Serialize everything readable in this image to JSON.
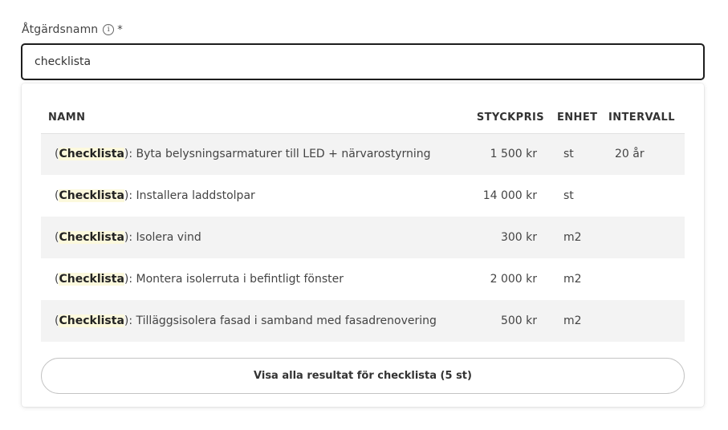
{
  "field": {
    "label": "Åtgärdsnamn",
    "required_marker": "*",
    "info_glyph": "i",
    "value": "checklista"
  },
  "results": {
    "columns": {
      "name": "NAMN",
      "price": "STYCKPRIS",
      "unit": "ENHET",
      "interval": "INTERVALL"
    },
    "highlight_color": "#fcf9dd",
    "row_stripe_color": "#f3f3f3",
    "rows": [
      {
        "prefix": "(",
        "tag": "Checklista",
        "suffix": "):",
        "name": "Byta belysningsarmaturer till LED + närvarostyrning",
        "price": "1 500 kr",
        "unit": "st",
        "interval": "20 år"
      },
      {
        "prefix": "(",
        "tag": "Checklista",
        "suffix": "):",
        "name": "Installera laddstolpar",
        "price": "14 000 kr",
        "unit": "st",
        "interval": ""
      },
      {
        "prefix": "(",
        "tag": "Checklista",
        "suffix": "):",
        "name": "Isolera vind",
        "price": "300 kr",
        "unit": "m2",
        "interval": ""
      },
      {
        "prefix": "(",
        "tag": "Checklista",
        "suffix": "):",
        "name": "Montera isolerruta i befintligt fönster",
        "price": "2 000 kr",
        "unit": "m2",
        "interval": ""
      },
      {
        "prefix": "(",
        "tag": "Checklista",
        "suffix": "):",
        "name": "Tilläggsisolera fasad i samband med fasadrenovering",
        "price": "500 kr",
        "unit": "m2",
        "interval": ""
      }
    ]
  },
  "show_all_button": "Visa alla resultat för checklista (5 st)"
}
